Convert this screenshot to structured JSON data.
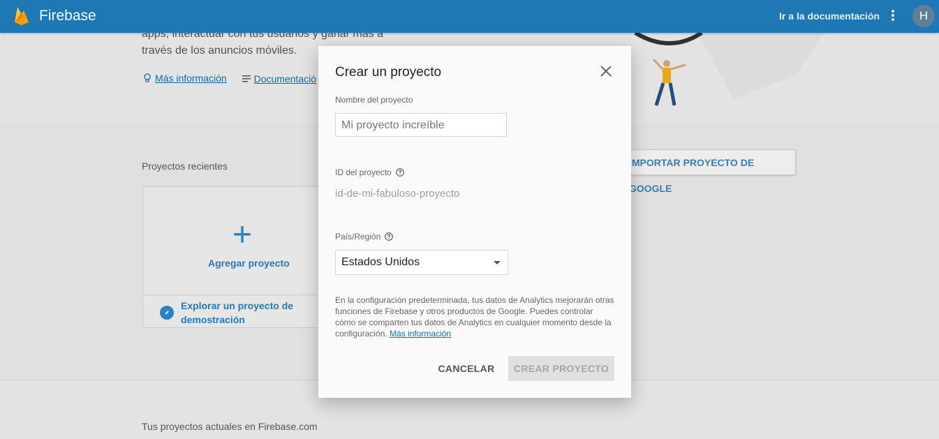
{
  "topbar": {
    "brand": "Firebase",
    "doc_link": "Ir a la documentación",
    "avatar_initial": "H"
  },
  "hero": {
    "line1": "apps, interactuar con tus usuarios y ganar más a",
    "line2": "través de los anuncios móviles.",
    "link_more": "Más información",
    "link_docs": "Documentació"
  },
  "projects": {
    "recent_title": "Proyectos recientes",
    "import_button": "IMPORTAR PROYECTO DE GOOGLE",
    "add_label": "Agregar proyecto",
    "explore_line1": "Explorar un proyecto de",
    "explore_line2": "demostración",
    "current_title": "Tus proyectos actuales en Firebase.com"
  },
  "dialog": {
    "title": "Crear un proyecto",
    "name_label": "Nombre del proyecto",
    "name_placeholder": "Mi proyecto increíble",
    "id_label": "ID del proyecto",
    "id_value": "id-de-mi-fabuloso-proyecto",
    "country_label": "País/Región",
    "country_value": "Estados Unidos",
    "info_text": "En la configuración predeterminada, tus datos de Analytics mejorarán otras funciones de Firebase y otros productos de Google. Puedes controlar cómo se comparten tus datos de Analytics en cualquier momento desde la configuración.",
    "info_link": "Más información",
    "cancel": "CANCELAR",
    "create": "CREAR PROYECTO"
  },
  "colors": {
    "topbar": "#1e78b4",
    "link": "#0a72b5",
    "accent": "#2b8bd1"
  }
}
